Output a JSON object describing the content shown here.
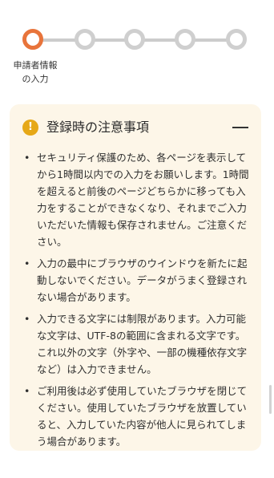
{
  "stepper": {
    "current_step": 1,
    "total_steps": 5,
    "current_label_line1": "申請者情報",
    "current_label_line2": "の入力"
  },
  "notice": {
    "title": "登録時の注意事項",
    "icon": "exclamation-icon",
    "collapse_icon": "minus-icon",
    "items": [
      "セキュリティ保護のため、各ページを表示してから1時間以内での入力をお願いします。1時間を超えると前後のページどちらかに移っても入力をすることができなくなり、それまでご入力いただいた情報も保存されません。ご注意ください。",
      "入力の最中にブラウザのウインドウを新たに起動しないでください。データがうまく登録されない場合があります。",
      "入力できる文字には制限があります。入力可能な文字は、UTF-8の範囲に含まれる文字です。これ以外の文字（外字や、一部の機種依存文字など）は入力できません。",
      "ご利用後は必ず使用していたブラウザを閉じてください。使用していたブラウザを放置していると、入力していた内容が他人に見られてしまう場合があります。"
    ]
  },
  "colors": {
    "accent": "#e8743b",
    "inactive_step": "#cfcfcf",
    "notice_bg": "#fdf6e8",
    "warning": "#e6a817"
  }
}
